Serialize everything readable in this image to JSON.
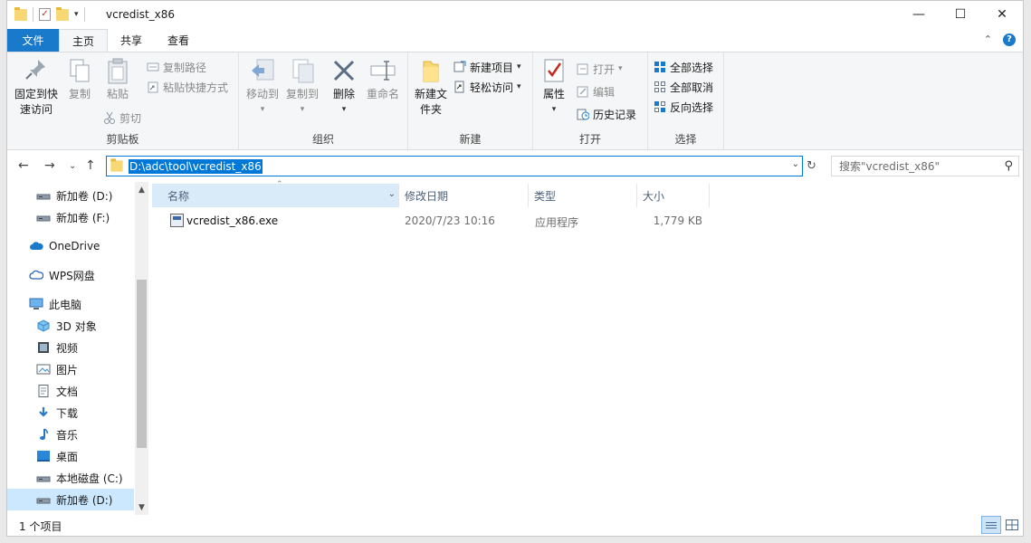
{
  "window": {
    "title": "vcredist_x86"
  },
  "tabs": {
    "file": "文件",
    "home": "主页",
    "share": "共享",
    "view": "查看"
  },
  "ribbon": {
    "clipboard": {
      "label": "剪贴板",
      "pin": "固定到快速访问",
      "copy": "复制",
      "paste": "粘贴",
      "copy_path": "复制路径",
      "paste_shortcut": "粘贴快捷方式",
      "cut": "剪切"
    },
    "organize": {
      "label": "组织",
      "move_to": "移动到",
      "copy_to": "复制到",
      "delete": "删除",
      "rename": "重命名"
    },
    "new": {
      "label": "新建",
      "new_folder": "新建文件夹",
      "new_item": "新建项目",
      "easy_access": "轻松访问"
    },
    "open": {
      "label": "打开",
      "properties": "属性",
      "open": "打开",
      "edit": "编辑",
      "history": "历史记录"
    },
    "select": {
      "label": "选择",
      "select_all": "全部选择",
      "select_none": "全部取消",
      "invert": "反向选择"
    }
  },
  "address": {
    "path": "D:\\adc\\tool\\vcredist_x86",
    "search_placeholder": "搜索\"vcredist_x86\""
  },
  "navpane": {
    "items": [
      {
        "label": "新加卷 (D:)",
        "icon": "drive-icon"
      },
      {
        "label": "新加卷 (F:)",
        "icon": "drive-icon"
      },
      {
        "label": "OneDrive",
        "icon": "cloud-icon"
      },
      {
        "label": "WPS网盘",
        "icon": "cloud-outline-icon"
      },
      {
        "label": "此电脑",
        "icon": "computer-icon"
      },
      {
        "label": "3D 对象",
        "icon": "cube-icon"
      },
      {
        "label": "视频",
        "icon": "video-icon"
      },
      {
        "label": "图片",
        "icon": "picture-icon"
      },
      {
        "label": "文档",
        "icon": "document-icon"
      },
      {
        "label": "下载",
        "icon": "download-icon"
      },
      {
        "label": "音乐",
        "icon": "music-icon"
      },
      {
        "label": "桌面",
        "icon": "desktop-icon"
      },
      {
        "label": "本地磁盘 (C:)",
        "icon": "drive-icon"
      },
      {
        "label": "新加卷 (D:)",
        "icon": "drive-icon"
      }
    ],
    "selected_index": 13
  },
  "filelist": {
    "columns": [
      "名称",
      "修改日期",
      "类型",
      "大小"
    ],
    "rows": [
      {
        "name": "vcredist_x86.exe",
        "modified": "2020/7/23 10:16",
        "type": "应用程序",
        "size": "1,779 KB"
      }
    ]
  },
  "status": {
    "count": "1 个项目"
  },
  "colors": {
    "accent": "#1979ca",
    "selection": "#cce8ff",
    "header_selected": "#d9ebf9"
  }
}
